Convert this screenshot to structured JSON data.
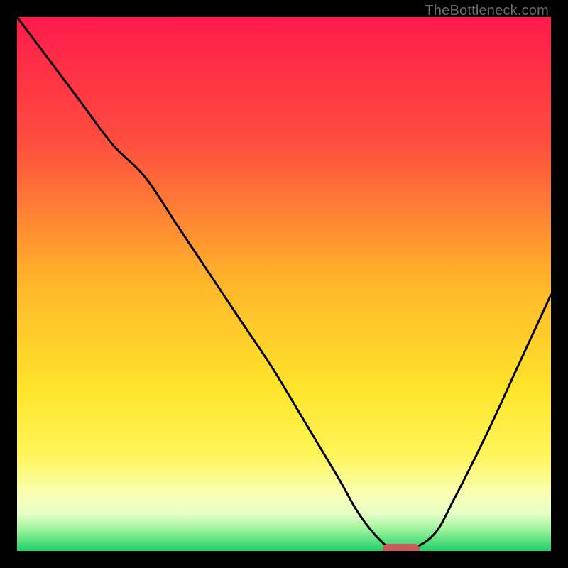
{
  "watermark": "TheBottleneck.com",
  "chart_data": {
    "type": "line",
    "title": "",
    "xlabel": "",
    "ylabel": "",
    "xlim": [
      0,
      100
    ],
    "ylim": [
      0,
      100
    ],
    "series": [
      {
        "name": "bottleneck-curve",
        "x": [
          0,
          6,
          12,
          18,
          24,
          30,
          36,
          42,
          48,
          54,
          60,
          64,
          68,
          71,
          73,
          78,
          82,
          88,
          94,
          100
        ],
        "values": [
          100,
          92,
          84,
          76,
          70,
          61,
          52,
          43,
          34,
          24,
          14,
          7,
          2,
          0,
          0,
          3,
          10,
          22,
          35,
          48
        ]
      }
    ],
    "gradient_stops": [
      {
        "pct": 0,
        "color": "#ff1a4c"
      },
      {
        "pct": 24,
        "color": "#ff4f3e"
      },
      {
        "pct": 50,
        "color": "#ffb72a"
      },
      {
        "pct": 70,
        "color": "#ffe52c"
      },
      {
        "pct": 82,
        "color": "#fff55a"
      },
      {
        "pct": 89,
        "color": "#f9ffb0"
      },
      {
        "pct": 93,
        "color": "#e8ffc8"
      },
      {
        "pct": 96,
        "color": "#9bf29b"
      },
      {
        "pct": 100,
        "color": "#21d06a"
      }
    ],
    "marker": {
      "x": 72,
      "y": 0,
      "color": "#c95a59"
    }
  }
}
